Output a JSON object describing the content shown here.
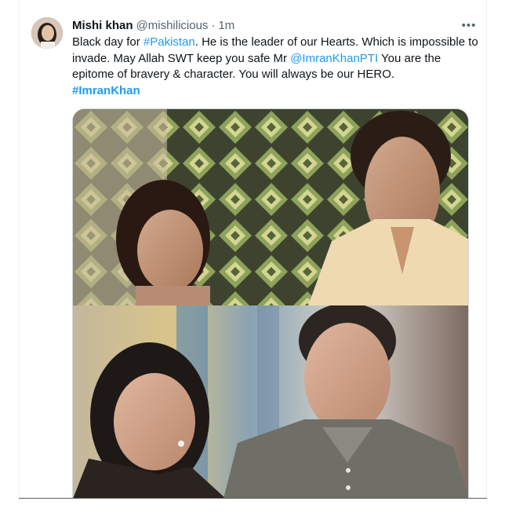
{
  "tweet": {
    "author_name": "Mishi khan",
    "handle": "@mishilicious",
    "separator": "·",
    "time": "1m",
    "more_icon": "ellipsis-icon",
    "text_parts": {
      "p1": "Black day for ",
      "hashtag1": "#Pakistan",
      "p2": ". He is the leader of our Hearts. Which is impossible to invade. May Allah SWT keep you safe Mr ",
      "mention": "@ImranKhanPTI",
      "p3": " You are the epitome of bravery & character. You will always be our HERO.",
      "hashtag2": "#ImranKhan"
    },
    "media": {
      "top_photo": "vintage-photo",
      "bottom_photo": "recent-photo"
    }
  },
  "colors": {
    "link": "#1d9bf0",
    "text": "#0f1419",
    "muted": "#536471",
    "border": "#eff3f4"
  }
}
